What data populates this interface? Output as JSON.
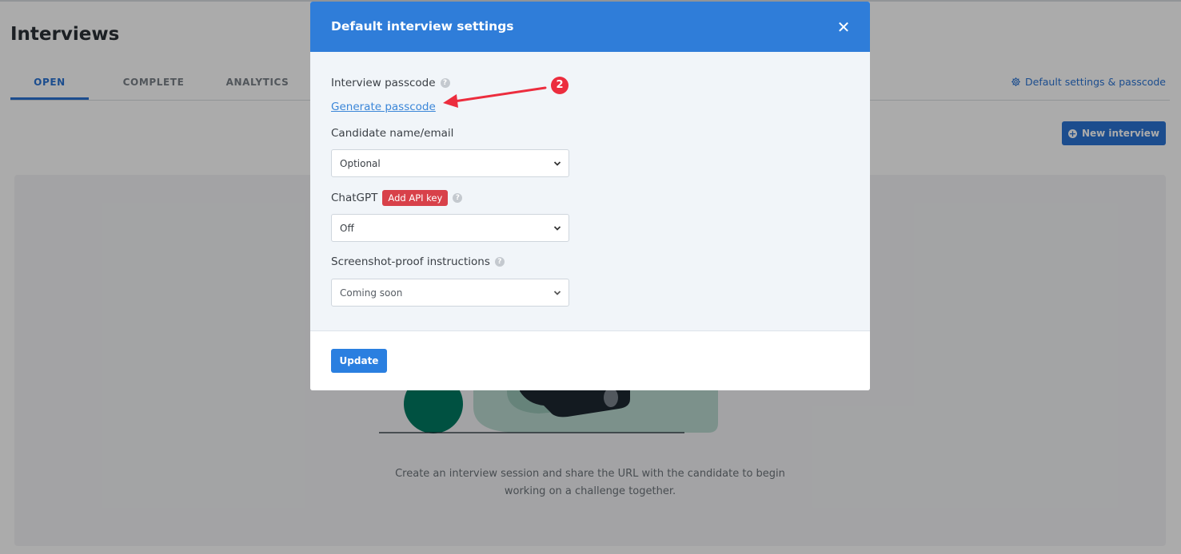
{
  "page": {
    "title": "Interviews",
    "tabs": [
      {
        "label": "OPEN",
        "active": true
      },
      {
        "label": "COMPLETE",
        "active": false
      },
      {
        "label": "ANALYTICS",
        "active": false
      }
    ],
    "default_settings_link": "Default settings & passcode",
    "new_interview_label": "New interview",
    "empty_text": "Create an interview session and share the URL with the candidate to begin working on a challenge together."
  },
  "modal": {
    "title": "Default interview settings",
    "close_icon": "close-icon",
    "passcode_label": "Interview passcode",
    "generate_passcode_link": "Generate passcode",
    "candidate_label": "Candidate name/email",
    "candidate_value": "Optional",
    "chatgpt_label": "ChatGPT",
    "add_api_key_label": "Add API key",
    "chatgpt_value": "Off",
    "screenshot_label": "Screenshot-proof instructions",
    "screenshot_value": "Coming soon",
    "update_label": "Update"
  },
  "annotation": {
    "step_number": "2"
  },
  "colors": {
    "primary": "#2a74d4",
    "header": "#2f7dd9",
    "danger": "#d8414a",
    "annotation": "#ec2d3e"
  }
}
